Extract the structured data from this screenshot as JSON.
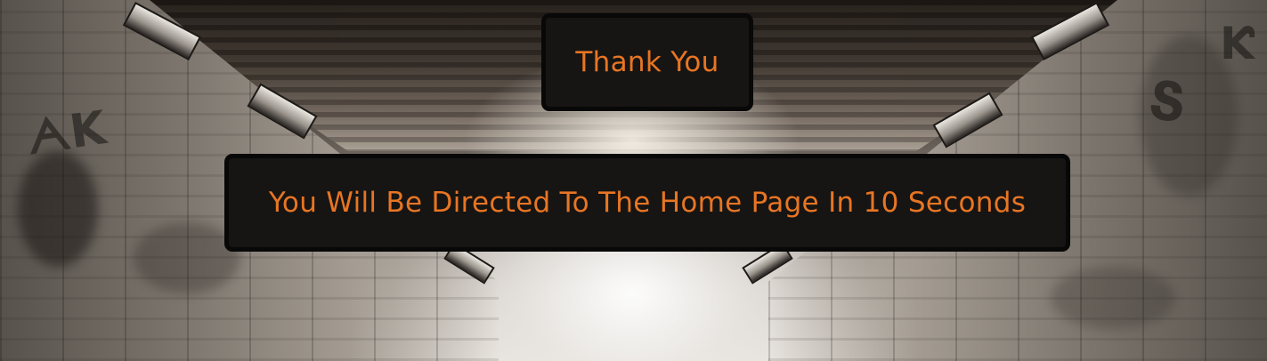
{
  "thank_you": {
    "heading": "Thank You"
  },
  "redirect": {
    "message": "You Will Be Directed To The Home Page In 10 Seconds"
  },
  "theme": {
    "accent_color": "#e87523",
    "card_background": "#161514",
    "card_border": "#080808"
  },
  "background": {
    "description_icon": "graffiti-tunnel-background"
  }
}
